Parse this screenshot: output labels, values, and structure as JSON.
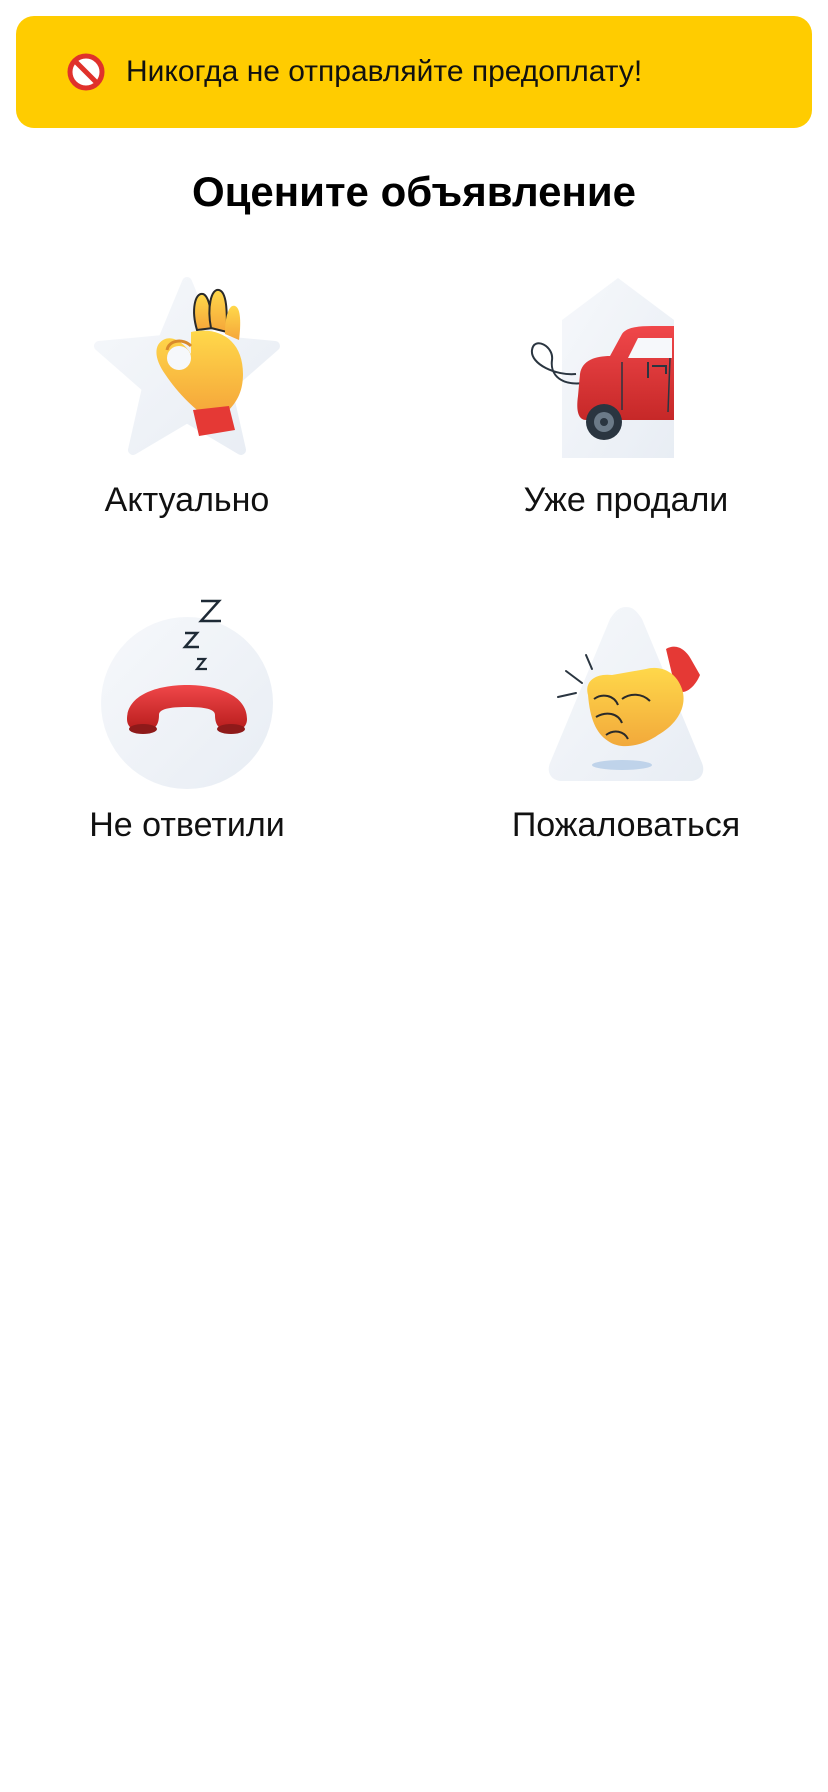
{
  "banner": {
    "icon": "prohibited-icon",
    "text": "Никогда не отправляйте предоплату!",
    "color": "#FFCC00"
  },
  "page": {
    "title": "Оцените объявление"
  },
  "options": [
    {
      "label": "Актуально",
      "icon": "ok-hand-star-icon"
    },
    {
      "label": "Уже продали",
      "icon": "car-leaving-house-icon"
    },
    {
      "label": "Не ответили",
      "icon": "sleeping-phone-icon"
    },
    {
      "label": "Пожаловаться",
      "icon": "fist-warning-icon"
    }
  ],
  "colors": {
    "accent_red": "#E53935",
    "hand_yellow": "#FBC83B",
    "shape_bg": "#EEF2F7"
  }
}
